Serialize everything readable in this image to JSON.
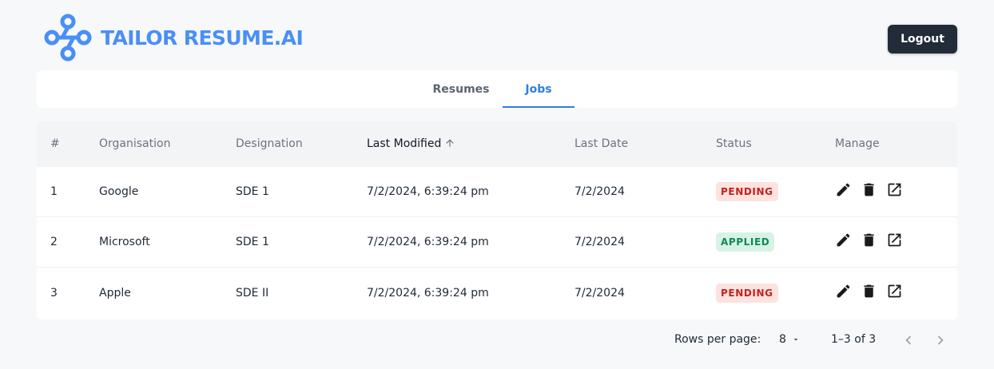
{
  "app": {
    "title": "TAILOR RESUME.AI",
    "brand_color": "#4a8ff5"
  },
  "header": {
    "logout_label": "Logout"
  },
  "tabs": [
    {
      "label": "Resumes",
      "active": false
    },
    {
      "label": "Jobs",
      "active": true
    }
  ],
  "table": {
    "headers": [
      "#",
      "Organisation",
      "Designation",
      "Last Modified",
      "Last Date",
      "Status",
      "Manage"
    ],
    "sort": {
      "column": "Last Modified",
      "direction": "ascending"
    },
    "rows": [
      {
        "num": "1",
        "org": "Google",
        "designation": "SDE 1",
        "modified": "7/2/2024, 6:39:24 pm",
        "last_date": "7/2/2024",
        "status": "PENDING"
      },
      {
        "num": "2",
        "org": "Microsoft",
        "designation": "SDE 1",
        "modified": "7/2/2024, 6:39:24 pm",
        "last_date": "7/2/2024",
        "status": "APPLIED"
      },
      {
        "num": "3",
        "org": "Apple",
        "designation": "SDE II",
        "modified": "7/2/2024, 6:39:24 pm",
        "last_date": "7/2/2024",
        "status": "PENDING"
      }
    ],
    "manage_icons": [
      "edit-icon",
      "delete-icon",
      "open-external-icon"
    ]
  },
  "pagination": {
    "rows_per_page_label": "Rows per page:",
    "rows_per_page": "8",
    "range": "1–3 of 3"
  },
  "colors": {
    "pending_bg": "#fde2e0",
    "pending_text": "#c4221c",
    "applied_bg": "#d6f3e5",
    "applied_text": "#0e8a55",
    "active_tab": "#2f7fdf"
  }
}
